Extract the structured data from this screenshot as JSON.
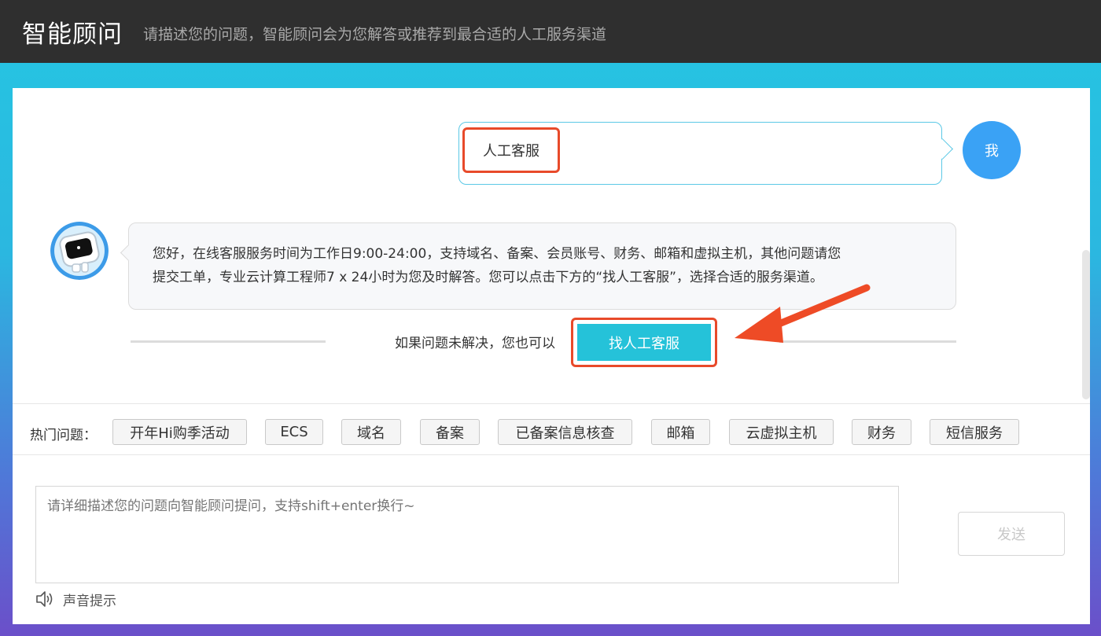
{
  "header": {
    "title": "智能顾问",
    "subtitle": "请描述您的问题，智能顾问会为您解答或推荐到最合适的人工服务渠道"
  },
  "chat": {
    "user_message": "人工客服",
    "user_avatar_label": "我",
    "bot_message_line1": "您好，在线客服服务时间为工作日9:00-24:00，支持域名、备案、会员账号、财务、邮箱和虚拟主机，其他问题请您",
    "bot_message_line2": "提交工单，专业云计算工程师7 x 24小时为您及时解答。您可以点击下方的“找人工客服”，选择合适的服务渠道。",
    "unresolved_text": "如果问题未解决，您也可以",
    "find_agent_button": "找人工客服"
  },
  "hot_questions": {
    "label": "热门问题：",
    "items": [
      "开年Hi购季活动",
      "ECS",
      "域名",
      "备案",
      "已备案信息核查",
      "邮箱",
      "云虚拟主机",
      "财务",
      "短信服务"
    ]
  },
  "composer": {
    "placeholder": "请详细描述您的问题向智能顾问提问，支持shift+enter换行~",
    "send_label": "发送",
    "sound_label": "声音提示"
  },
  "colors": {
    "header_bg": "#2f2f2f",
    "accent": "#25c2d9",
    "user_avatar": "#3aa2f5",
    "highlight": "#e84a2a"
  },
  "icons": {
    "user_avatar": "user-avatar-icon",
    "bot_avatar": "robot-icon",
    "speaker": "speaker-icon",
    "arrow": "annotation-arrow-icon"
  }
}
